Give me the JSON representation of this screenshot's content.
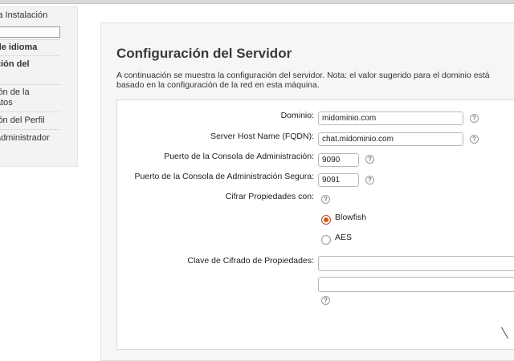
{
  "sidebar": {
    "items": [
      {
        "label": "la Instalación"
      },
      {
        "label": "de idioma"
      },
      {
        "label": "ción del"
      },
      {
        "label": "ión de la"
      },
      {
        "label": "atos"
      },
      {
        "label": "ión del Perfil"
      },
      {
        "label": "administrador"
      }
    ]
  },
  "main": {
    "title": "Configuración del Servidor",
    "description": "A continuación se muestra la configuración del servidor. Nota: el valor sugerido para el dominio está basado en la configuración de la red en esta máquina.",
    "fields": {
      "domain": {
        "label": "Dominio:",
        "value": "midominio.com"
      },
      "fqdn": {
        "label": "Server Host Name (FQDN):",
        "value": "chat.midominio.com"
      },
      "admin_port": {
        "label": "Puerto de la Consola de Administración:",
        "value": "9090"
      },
      "admin_secure_port": {
        "label": "Puerto de la Consola de Administración Segura:",
        "value": "9091"
      },
      "encrypt": {
        "label": "Cifrar Propiedades con:",
        "options": [
          "Blowfish",
          "AES"
        ],
        "selected": "Blowfish"
      },
      "encrypt_key": {
        "label": "Clave de Cifrado de Propiedades:",
        "value": "",
        "confirm_value": ""
      }
    },
    "help_symbol": "?"
  },
  "colors": {
    "radio_selected": "#d45a22"
  }
}
